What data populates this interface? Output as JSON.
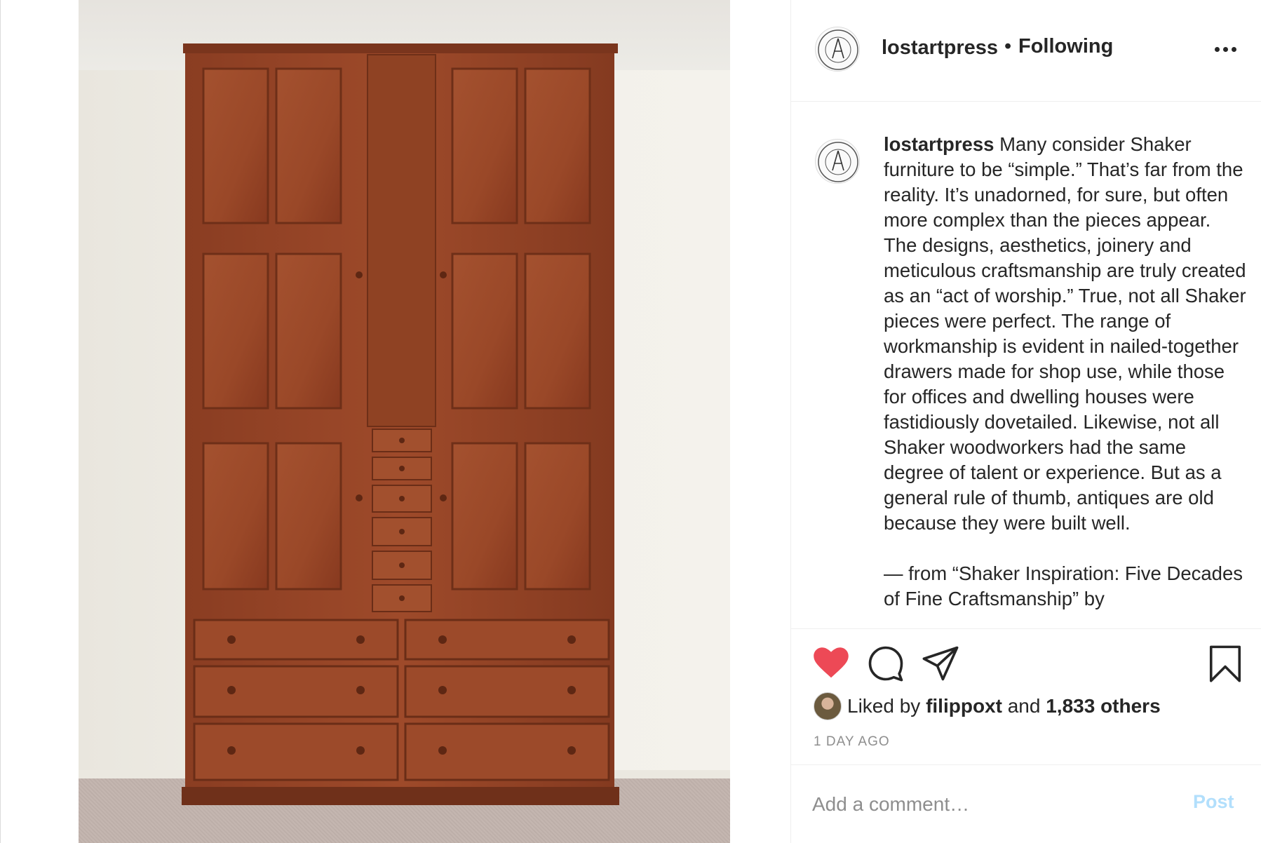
{
  "post": {
    "username": "lostartpress",
    "separator": "•",
    "follow_status": "Following",
    "more_icon": "more-horizontal-icon"
  },
  "caption": {
    "username": "lostartpress",
    "text": " Many consider Shaker furniture to be “simple.” That’s far from the reality. It’s unadorned, for sure, but often more complex than the pieces appear. The designs, aesthetics, joinery and meticulous craftsmanship are truly created as an “act of worship.” True, not all Shaker pieces were perfect. The range of workmanship is evident in nailed-together drawers made for shop use, while those for offices and dwelling houses were fastidiously dovetailed. Likewise, not all Shaker woodworkers had the same degree of talent or experience. But as a general rule of thumb, antiques are old because they were built well.",
    "attribution": "— from “Shaker Inspiration: Five Decades of Fine Craftsmanship” by"
  },
  "actions": {
    "like_icon": "heart-filled-icon",
    "comment_icon": "comment-icon",
    "share_icon": "share-icon",
    "save_icon": "bookmark-icon",
    "like_color": "#ed4956"
  },
  "likes": {
    "prefix": "Liked by",
    "user": "filippoxt",
    "conjunction": "and",
    "others": "1,833 others"
  },
  "timestamp": "1 DAY AGO",
  "comment": {
    "placeholder": "Add a comment…",
    "post_label": "Post",
    "post_color": "#b2dffc"
  }
}
